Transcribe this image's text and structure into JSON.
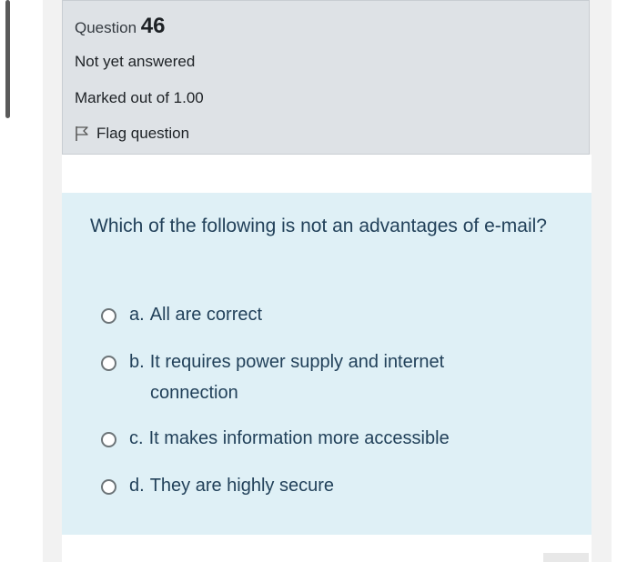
{
  "question_info": {
    "prefix": "Question",
    "number": "46",
    "state": "Not yet answered",
    "marks": "Marked out of 1.00",
    "flag_label": "Flag question"
  },
  "question": {
    "text": "Which of the following is not an advantages of e-mail?",
    "options": [
      {
        "letter": "a.",
        "text": "All are correct"
      },
      {
        "letter": "b.",
        "text_line1": "It requires power supply and internet",
        "text_line2": "connection"
      },
      {
        "letter": "c.",
        "text": "It makes information more accessible"
      },
      {
        "letter": "d.",
        "text": "They are highly secure"
      }
    ]
  },
  "colors": {
    "info_bg": "#dee2e6",
    "question_bg": "#dff0f6",
    "question_text": "#22415a"
  }
}
